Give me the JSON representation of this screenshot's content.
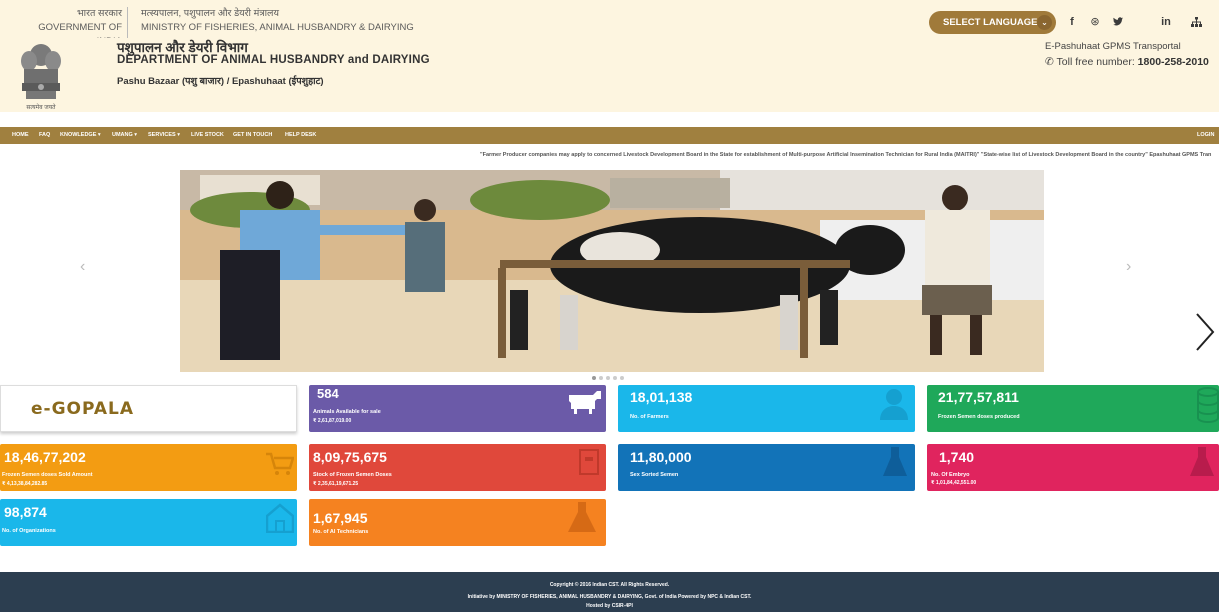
{
  "topbar": {
    "gov_hindi": "भारत सरकार",
    "gov_english": "GOVERNMENT OF INDIA",
    "ministry_hindi": "मत्स्यपालन, पशुपालन और डेयरी मंत्रालय",
    "ministry_english": "MINISTRY OF FISHERIES, ANIMAL HUSBANDRY & DAIRYING",
    "language_button": "SELECT LANGUAGE",
    "social_icons": [
      "facebook-icon",
      "help-icon",
      "twitter-icon",
      "linkedin-icon",
      "sitemap-icon"
    ],
    "social_glyphs": [
      "f",
      "⊛",
      "🐦",
      "in",
      "⛬"
    ]
  },
  "header": {
    "dept_hindi": "पशुपालन और डेयरी विभाग",
    "dept_english": "DEPARTMENT OF ANIMAL HUSBANDRY and DAIRYING",
    "portal": "Pashu Bazaar (पशु बाजार) / Epashuhaat (ईपशुहाट)",
    "emblem_caption": "सत्यमेव जयते",
    "gpms": "E-Pashuhaat GPMS Transportal",
    "tollfree_label": "Toll free number:",
    "tollfree_number": "1800-258-2010"
  },
  "nav": {
    "items": [
      "HOME",
      "FAQ",
      "KNOWLEDGE ▾",
      "UMANG ▾",
      "SERVICES ▾",
      "LIVE STOCK",
      "GET IN TOUCH",
      "HELP DESK"
    ],
    "login": "LOGIN"
  },
  "marquee": "\"Farmer Producer companies may apply to concerned Livestock Development Board in the State for establishment of Multi-purpose Artificial Insemination Technician for Rural India (MAITRI)\"  \"State-wise list of Livestock Development Board in the country\"  Epashuhaat GPMS Tran",
  "gopala": "e-GOPALA",
  "stats": [
    {
      "value": "584",
      "label": "Animals Available for sale",
      "sub": "₹ 2,61,87,019.00",
      "icon": "cow-icon",
      "color": "#6b5aa8"
    },
    {
      "value": "18,01,138",
      "label": "No. of Farmers",
      "sub": "",
      "icon": "person-icon",
      "color": "#1ab7ea"
    },
    {
      "value": "21,77,57,811",
      "label": "Frozen Semen doses produced",
      "sub": "",
      "icon": "database-icon",
      "color": "#1fa85a"
    },
    {
      "value": "18,46,77,202",
      "label": "Frozen Semen doses Sold Amount",
      "sub": "₹ 4,13,38,84,282.85",
      "icon": "cart-icon",
      "color": "#f39c12"
    },
    {
      "value": "8,09,75,675",
      "label": "Stock of Frozen Semen Doses",
      "sub": "₹ 2,35,61,19,671.25",
      "icon": "box-icon",
      "color": "#e0483b"
    },
    {
      "value": "11,80,000",
      "label": "Sex Sorted Semen",
      "sub": "",
      "icon": "flask-icon",
      "color": "#1273b8"
    },
    {
      "value": "1,740",
      "label": "No. Of Embryo",
      "sub": "₹ 1,01,84,42,551.00",
      "icon": "flask-icon",
      "color": "#e0245e"
    },
    {
      "value": "98,874",
      "label": "No. of Organizations",
      "sub": "",
      "icon": "home-icon",
      "color": "#1ab7ea"
    },
    {
      "value": "1,67,945",
      "label": "No. of AI Technicians",
      "sub": "",
      "icon": "flask-icon",
      "color": "#f58220"
    }
  ],
  "footer": {
    "copyright": "Copyright © 2016 Indian CST. All Rights Reserved.",
    "initiative": "Initiative by MINISTRY OF FISHERIES, ANIMAL HUSBANDRY & DAIRYING, Govt. of India Powered by NPC & Indian CST.",
    "hosted": "Hosted by CSIR-4PI"
  }
}
